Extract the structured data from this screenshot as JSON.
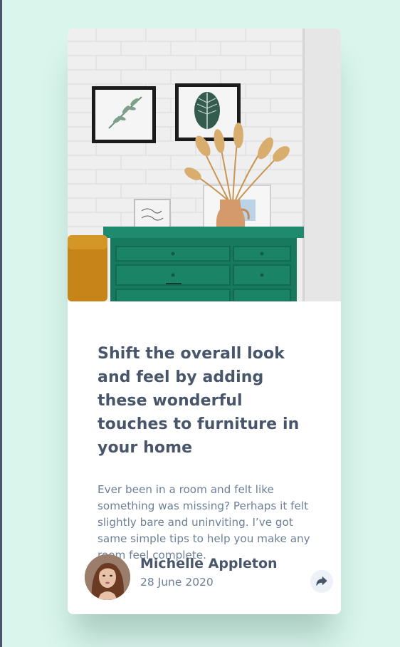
{
  "article": {
    "headline": "Shift the overall look and feel by adding these wonderful touches to furniture in your home",
    "excerpt": "Ever been in a room and felt like something was missing? Perhaps it felt slightly bare and uninviting. I’ve got same simple tips to help you make any room feel complete."
  },
  "author": {
    "name": "Michelle Appleton",
    "date": "28 June 2020"
  },
  "colors": {
    "page_background": "#d9f5ec",
    "card_background": "#ffffff",
    "heading_text": "#48556a",
    "body_text": "#6e8098",
    "share_button_background": "#ecf2f8"
  },
  "icons": {
    "share": "share-arrow-icon"
  }
}
